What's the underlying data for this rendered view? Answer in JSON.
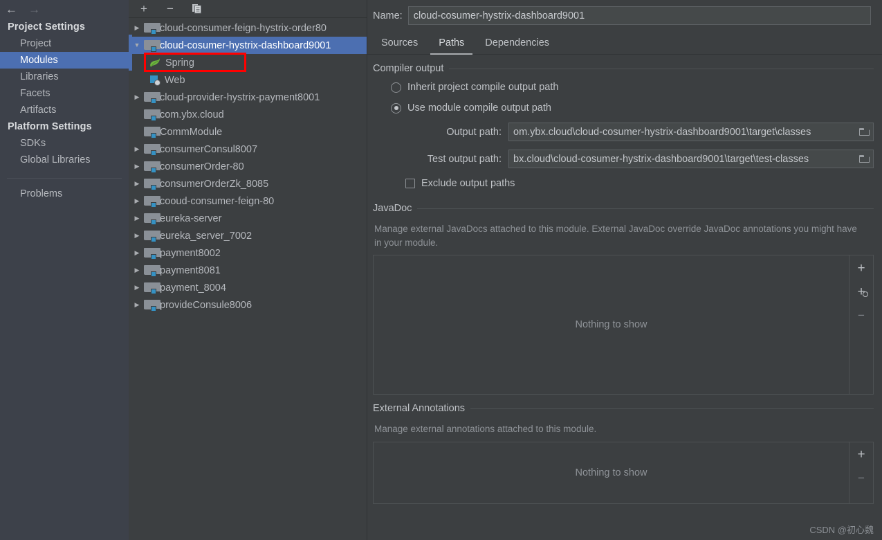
{
  "sidebar": {
    "back_arrow": "←",
    "forward_arrow": "→",
    "groups": [
      {
        "title": "Project Settings",
        "items": [
          {
            "label": "Project",
            "selected": false
          },
          {
            "label": "Modules",
            "selected": true
          },
          {
            "label": "Libraries",
            "selected": false
          },
          {
            "label": "Facets",
            "selected": false
          },
          {
            "label": "Artifacts",
            "selected": false
          }
        ]
      },
      {
        "title": "Platform Settings",
        "items": [
          {
            "label": "SDKs",
            "selected": false
          },
          {
            "label": "Global Libraries",
            "selected": false
          }
        ]
      }
    ],
    "problems_label": "Problems"
  },
  "tree_panel": {
    "toolbar": {
      "add_label": "+",
      "remove_label": "−",
      "copy_label": "copy-icon"
    },
    "items": [
      {
        "label": "cloud-consumer-feign-hystrix-order80",
        "type": "module",
        "expandable": true,
        "expanded": false,
        "selected": false,
        "depth": 0
      },
      {
        "label": "cloud-cosumer-hystrix-dashboard9001",
        "type": "module",
        "expandable": true,
        "expanded": true,
        "selected": true,
        "depth": 0
      },
      {
        "label": "Spring",
        "type": "spring",
        "expandable": false,
        "expanded": false,
        "selected": false,
        "depth": 1,
        "highlighted": true
      },
      {
        "label": "Web",
        "type": "web",
        "expandable": false,
        "expanded": false,
        "selected": false,
        "depth": 1
      },
      {
        "label": "cloud-provider-hystrix-payment8001",
        "type": "module",
        "expandable": true,
        "expanded": false,
        "selected": false,
        "depth": 0
      },
      {
        "label": "com.ybx.cloud",
        "type": "module",
        "expandable": false,
        "expanded": false,
        "selected": false,
        "depth": 0
      },
      {
        "label": "CommModule",
        "type": "module",
        "expandable": false,
        "expanded": false,
        "selected": false,
        "depth": 0
      },
      {
        "label": "consumerConsul8007",
        "type": "module",
        "expandable": true,
        "expanded": false,
        "selected": false,
        "depth": 0
      },
      {
        "label": "consumerOrder-80",
        "type": "module",
        "expandable": true,
        "expanded": false,
        "selected": false,
        "depth": 0
      },
      {
        "label": "consumerOrderZk_8085",
        "type": "module",
        "expandable": true,
        "expanded": false,
        "selected": false,
        "depth": 0
      },
      {
        "label": "cooud-consumer-feign-80",
        "type": "module",
        "expandable": true,
        "expanded": false,
        "selected": false,
        "depth": 0
      },
      {
        "label": "eureka-server",
        "type": "module",
        "expandable": true,
        "expanded": false,
        "selected": false,
        "depth": 0
      },
      {
        "label": "eureka_server_7002",
        "type": "module",
        "expandable": true,
        "expanded": false,
        "selected": false,
        "depth": 0
      },
      {
        "label": "payment8002",
        "type": "module",
        "expandable": true,
        "expanded": false,
        "selected": false,
        "depth": 0
      },
      {
        "label": "payment8081",
        "type": "module",
        "expandable": true,
        "expanded": false,
        "selected": false,
        "depth": 0
      },
      {
        "label": "payment_8004",
        "type": "module",
        "expandable": true,
        "expanded": false,
        "selected": false,
        "depth": 0
      },
      {
        "label": "provideConsule8006",
        "type": "module",
        "expandable": true,
        "expanded": false,
        "selected": false,
        "depth": 0
      }
    ],
    "highlight_color": "#ff0000",
    "selection_color": "#4c6fb1"
  },
  "detail": {
    "name_label": "Name:",
    "name_value": "cloud-cosumer-hystrix-dashboard9001",
    "tabs": [
      {
        "label": "Sources",
        "active": false
      },
      {
        "label": "Paths",
        "active": true
      },
      {
        "label": "Dependencies",
        "active": false
      }
    ],
    "compiler_output": {
      "section_title": "Compiler output",
      "radio_inherit": "Inherit project compile output path",
      "radio_module": "Use module compile output path",
      "radio_selected": "module",
      "output_path_label": "Output path:",
      "output_path_value": "om.ybx.cloud\\cloud-cosumer-hystrix-dashboard9001\\target\\classes",
      "test_output_path_label": "Test output path:",
      "test_output_path_value": "bx.cloud\\cloud-cosumer-hystrix-dashboard9001\\target\\test-classes",
      "exclude_label": "Exclude output paths",
      "exclude_checked": false,
      "browse_icon": "folder-icon"
    },
    "javadoc": {
      "section_title": "JavaDoc",
      "description": "Manage external JavaDocs attached to this module. External JavaDoc override JavaDoc annotations you might have in your module.",
      "empty_text": "Nothing to show",
      "buttons": [
        {
          "name": "add",
          "label": "+"
        },
        {
          "name": "add-url",
          "label": "+"
        },
        {
          "name": "remove",
          "label": "−"
        }
      ]
    },
    "external_annotations": {
      "section_title": "External Annotations",
      "description": "Manage external annotations attached to this module.",
      "empty_text": "Nothing to show",
      "buttons": [
        {
          "name": "add",
          "label": "+"
        },
        {
          "name": "remove",
          "label": "−"
        }
      ]
    },
    "watermark": "CSDN @初心魏"
  }
}
